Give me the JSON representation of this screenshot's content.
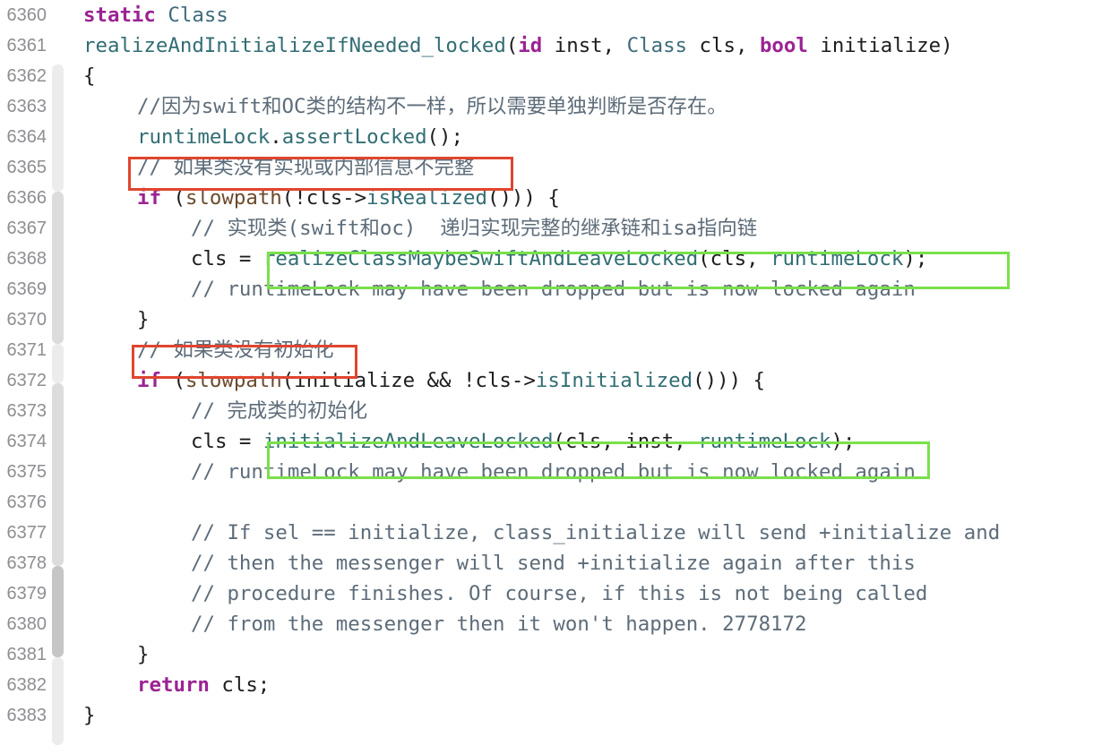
{
  "editor": {
    "colors": {
      "background": "#ffffff",
      "line_number": "#8e8e93",
      "keyword": "#9b2393",
      "type": "#3e6b7a",
      "function": "#326d74",
      "comment": "#5d6c79",
      "highlight_red": "#e0452f",
      "highlight_green": "#7ae04b"
    },
    "lines": [
      {
        "num": "6360",
        "indent": 0,
        "tokens": [
          [
            "kw",
            "static"
          ],
          [
            "t",
            " "
          ],
          [
            "ty",
            "Class"
          ]
        ]
      },
      {
        "num": "6361",
        "indent": 0,
        "tokens": [
          [
            "fn",
            "realizeAndInitializeIfNeeded_locked"
          ],
          [
            "t",
            "("
          ],
          [
            "kw",
            "id"
          ],
          [
            "t",
            " inst, "
          ],
          [
            "ty",
            "Class"
          ],
          [
            "t",
            " cls, "
          ],
          [
            "kw",
            "bool"
          ],
          [
            "t",
            " initialize)"
          ]
        ]
      },
      {
        "num": "6362",
        "indent": 0,
        "tokens": [
          [
            "t",
            "{"
          ]
        ]
      },
      {
        "num": "6363",
        "indent": 1,
        "tokens": [
          [
            "cm",
            "//因为swift和OC类的结构不一样，所以需要单独判断是否存在。"
          ]
        ]
      },
      {
        "num": "6364",
        "indent": 1,
        "tokens": [
          [
            "fn",
            "runtimeLock"
          ],
          [
            "t",
            "."
          ],
          [
            "fn",
            "assertLocked"
          ],
          [
            "t",
            "();"
          ]
        ]
      },
      {
        "num": "6365",
        "indent": 1,
        "tokens": [
          [
            "cm",
            "// 如果类没有实现或内部信息不完整"
          ]
        ]
      },
      {
        "num": "6366",
        "indent": 1,
        "tokens": [
          [
            "kw",
            "if"
          ],
          [
            "t",
            " ("
          ],
          [
            "call",
            "slowpath"
          ],
          [
            "t",
            "(!cls->"
          ],
          [
            "fn",
            "isRealized"
          ],
          [
            "t",
            "())) {"
          ]
        ]
      },
      {
        "num": "6367",
        "indent": 2,
        "tokens": [
          [
            "cm",
            "// 实现类(swift和oc)  递归实现完整的继承链和isa指向链"
          ]
        ]
      },
      {
        "num": "6368",
        "indent": 2,
        "tokens": [
          [
            "t",
            "cls = "
          ],
          [
            "fn",
            "realizeClassMaybeSwiftAndLeaveLocked"
          ],
          [
            "t",
            "(cls, "
          ],
          [
            "fn",
            "runtimeLock"
          ],
          [
            "t",
            ");"
          ]
        ]
      },
      {
        "num": "6369",
        "indent": 2,
        "tokens": [
          [
            "cm",
            "// runtimeLock may have been dropped but is now locked again"
          ]
        ]
      },
      {
        "num": "6370",
        "indent": 1,
        "tokens": [
          [
            "t",
            "}"
          ]
        ]
      },
      {
        "num": "6371",
        "indent": 1,
        "tokens": [
          [
            "cm",
            "// 如果类没有初始化"
          ]
        ]
      },
      {
        "num": "6372",
        "indent": 1,
        "tokens": [
          [
            "kw",
            "if"
          ],
          [
            "t",
            " ("
          ],
          [
            "call",
            "slowpath"
          ],
          [
            "t",
            "(initialize && !cls->"
          ],
          [
            "fn",
            "isInitialized"
          ],
          [
            "t",
            "())) {"
          ]
        ]
      },
      {
        "num": "6373",
        "indent": 2,
        "tokens": [
          [
            "cm",
            "// 完成类的初始化"
          ]
        ]
      },
      {
        "num": "6374",
        "indent": 2,
        "tokens": [
          [
            "t",
            "cls = "
          ],
          [
            "fn",
            "initializeAndLeaveLocked"
          ],
          [
            "t",
            "(cls, inst, "
          ],
          [
            "fn",
            "runtimeLock"
          ],
          [
            "t",
            ");"
          ]
        ]
      },
      {
        "num": "6375",
        "indent": 2,
        "tokens": [
          [
            "cm",
            "// runtimeLock may have been dropped but is now locked again"
          ]
        ]
      },
      {
        "num": "6376",
        "indent": 0,
        "tokens": []
      },
      {
        "num": "6377",
        "indent": 2,
        "tokens": [
          [
            "cm",
            "// If sel == initialize, class_initialize will send +initialize and"
          ]
        ]
      },
      {
        "num": "6378",
        "indent": 2,
        "tokens": [
          [
            "cm",
            "// then the messenger will send +initialize again after this"
          ]
        ]
      },
      {
        "num": "6379",
        "indent": 2,
        "tokens": [
          [
            "cm",
            "// procedure finishes. Of course, if this is not being called"
          ]
        ]
      },
      {
        "num": "6380",
        "indent": 2,
        "tokens": [
          [
            "cm",
            "// from the messenger then it won't happen. 2778172"
          ]
        ]
      },
      {
        "num": "6381",
        "indent": 1,
        "tokens": [
          [
            "t",
            "}"
          ]
        ]
      },
      {
        "num": "6382",
        "indent": 1,
        "tokens": [
          [
            "kw",
            "return"
          ],
          [
            "t",
            " cls;"
          ]
        ]
      },
      {
        "num": "6383",
        "indent": 0,
        "tokens": [
          [
            "t",
            "}"
          ]
        ]
      }
    ],
    "highlights": [
      {
        "kind": "red",
        "label": "comment-not-realized"
      },
      {
        "kind": "green",
        "label": "realize-call"
      },
      {
        "kind": "red",
        "label": "comment-not-initialized"
      },
      {
        "kind": "green",
        "label": "initialize-call"
      }
    ]
  }
}
